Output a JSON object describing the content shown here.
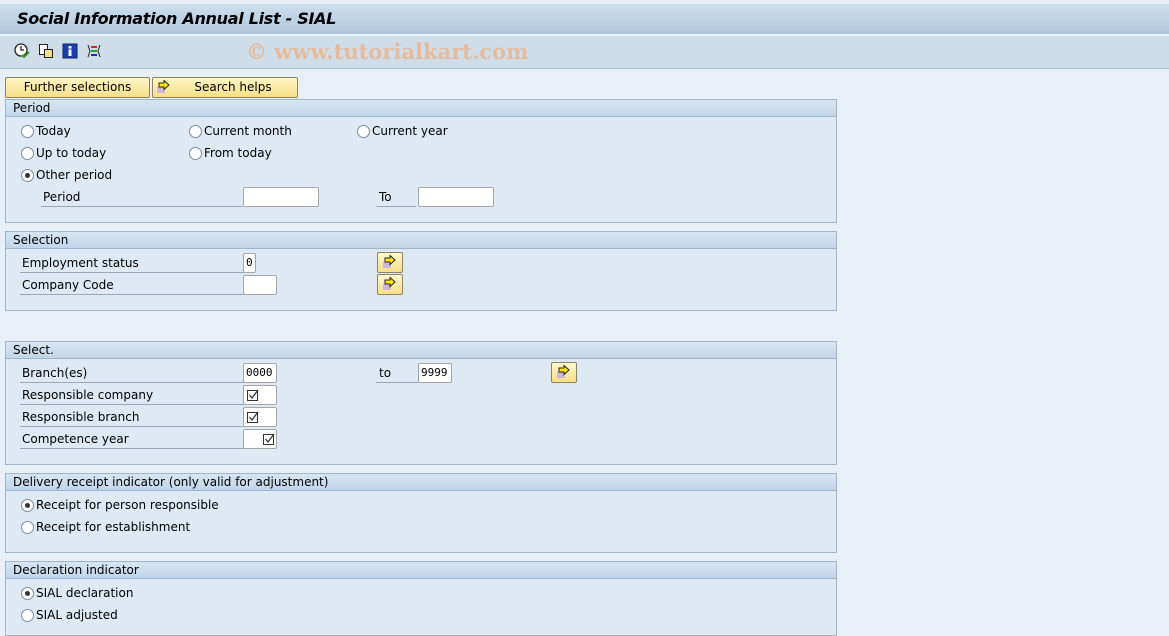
{
  "window": {
    "title": "Social Information Annual List - SIAL",
    "watermark": "© www.tutorialkart.com"
  },
  "toolbar": {
    "icons": [
      "execute-clock-icon",
      "copy-variant-icon",
      "info-icon",
      "selection-options-icon"
    ]
  },
  "buttons": {
    "further_selections": "Further selections",
    "search_helps": "Search helps"
  },
  "period": {
    "header": "Period",
    "options": [
      {
        "label": "Today",
        "checked": false
      },
      {
        "label": "Current month",
        "checked": false
      },
      {
        "label": "Current year",
        "checked": false
      },
      {
        "label": "Up to today",
        "checked": false
      },
      {
        "label": "From today",
        "checked": false
      },
      {
        "label": "Other period",
        "checked": true
      }
    ],
    "period_label": "Period",
    "period_from": "",
    "to_label": "To",
    "period_to": ""
  },
  "selection": {
    "header": "Selection",
    "employment_status_label": "Employment status",
    "employment_status_value": "0",
    "company_code_label": "Company Code",
    "company_code_value": ""
  },
  "select": {
    "header": "Select.",
    "branches_label": "Branch(es)",
    "branches_from": "0000",
    "to_label": "to",
    "branches_to": "9999",
    "responsible_company_label": "Responsible company",
    "responsible_company_checked": true,
    "responsible_branch_label": "Responsible branch",
    "responsible_branch_checked": true,
    "competence_year_label": "Competence year",
    "competence_year_checked": true
  },
  "delivery": {
    "header": "Delivery receipt indicator (only valid for adjustment)",
    "options": [
      {
        "label": "Receipt for person responsible",
        "checked": true
      },
      {
        "label": "Receipt for establishment",
        "checked": false
      }
    ]
  },
  "declaration": {
    "header": "Declaration indicator",
    "options": [
      {
        "label": "SIAL declaration",
        "checked": true
      },
      {
        "label": "SIAL adjusted",
        "checked": false
      }
    ]
  }
}
